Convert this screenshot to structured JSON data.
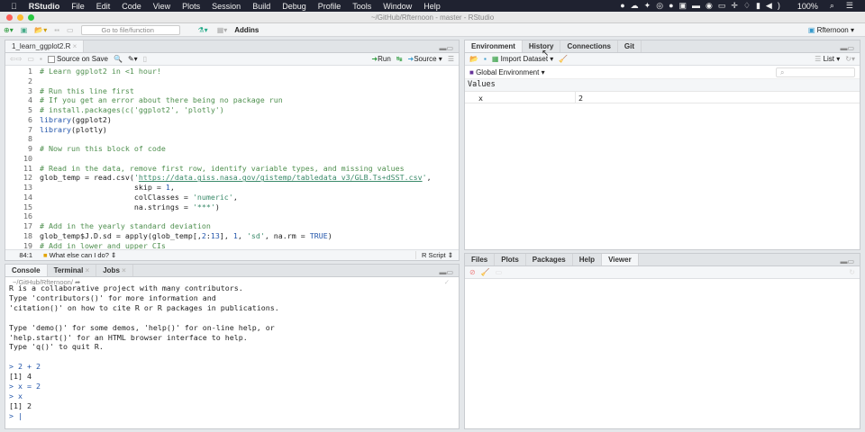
{
  "menubar": {
    "items": [
      "RStudio",
      "File",
      "Edit",
      "Code",
      "View",
      "Plots",
      "Session",
      "Build",
      "Debug",
      "Profile",
      "Tools",
      "Window",
      "Help"
    ],
    "status": "100%",
    "wifi": "wifi-icon"
  },
  "window_title": "~/GitHub/Rfternoon - master - RStudio",
  "toolbar": {
    "goto_placeholder": "Go to file/function",
    "addins": "Addins",
    "project": "Rfternoon"
  },
  "editor": {
    "tab": "1_learn_ggplot2.R",
    "source_on_save": "Source on Save",
    "run": "Run",
    "source": "Source",
    "position": "84:1",
    "section": "What else can I do?",
    "filetype": "R Script",
    "lines": [
      [
        [
          "c-com",
          "# Learn ggplot2 in <1 hour!"
        ]
      ],
      [],
      [
        [
          "c-com",
          "# Run this line first"
        ]
      ],
      [
        [
          "c-com",
          "# If you get an error about there being no package run"
        ]
      ],
      [
        [
          "c-com",
          "# install.packages(c('ggplot2', 'plotly')"
        ]
      ],
      [
        [
          "c-kw",
          "library"
        ],
        [
          "",
          "(ggplot2)"
        ]
      ],
      [
        [
          "c-kw",
          "library"
        ],
        [
          "",
          "(plotly)"
        ]
      ],
      [],
      [
        [
          "c-com",
          "# Now run this block of code"
        ]
      ],
      [],
      [
        [
          "c-com",
          "# Read in the data, remove first row, identify variable types, and missing values"
        ]
      ],
      [
        [
          "",
          "glob_temp = read.csv("
        ],
        [
          "c-str",
          "'"
        ],
        [
          "c-url",
          "https://data.giss.nasa.gov/gistemp/tabledata_v3/GLB.Ts+dSST.csv"
        ],
        [
          "c-str",
          "'"
        ],
        [
          "",
          ","
        ]
      ],
      [
        [
          "",
          "                     skip = "
        ],
        [
          "c-num",
          "1"
        ],
        [
          "",
          ","
        ]
      ],
      [
        [
          "",
          "                     colClasses = "
        ],
        [
          "c-str",
          "'numeric'"
        ],
        [
          "",
          ","
        ]
      ],
      [
        [
          "",
          "                     na.strings = "
        ],
        [
          "c-str",
          "'***'"
        ],
        [
          "",
          ")"
        ]
      ],
      [],
      [
        [
          "c-com",
          "# Add in the yearly standard deviation"
        ]
      ],
      [
        [
          "",
          "glob_temp$J.D.sd = apply(glob_temp[,"
        ],
        [
          "c-num",
          "2"
        ],
        [
          "",
          ":"
        ],
        [
          "c-num",
          "13"
        ],
        [
          "",
          "], "
        ],
        [
          "c-num",
          "1"
        ],
        [
          "",
          ", "
        ],
        [
          "c-str",
          "'sd'"
        ],
        [
          "",
          ", na.rm = "
        ],
        [
          "c-kw",
          "TRUE"
        ],
        [
          "",
          ")"
        ]
      ],
      [
        [
          "c-com",
          "# Add in lower and upper CIs"
        ]
      ]
    ]
  },
  "console": {
    "tabs": [
      "Console",
      "Terminal",
      "Jobs"
    ],
    "path": "~/GitHub/Rfternoon/",
    "lines": [
      "R is a collaborative project with many contributors.",
      "Type 'contributors()' for more information and",
      "'citation()' on how to cite R or R packages in publications.",
      "",
      "Type 'demo()' for some demos, 'help()' for on-line help, or",
      "'help.start()' for an HTML browser interface to help.",
      "Type 'q()' to quit R.",
      "",
      "> 2 + 2",
      "[1] 4",
      "> x = 2",
      "> x",
      "[1] 2",
      "> "
    ]
  },
  "environment": {
    "tabs": [
      "Environment",
      "History",
      "Connections",
      "Git"
    ],
    "import": "Import Dataset",
    "view": "List",
    "scope": "Global Environment",
    "section": "Values",
    "rows": [
      {
        "name": "x",
        "value": "2"
      }
    ]
  },
  "viewer": {
    "tabs": [
      "Files",
      "Plots",
      "Packages",
      "Help",
      "Viewer"
    ]
  }
}
